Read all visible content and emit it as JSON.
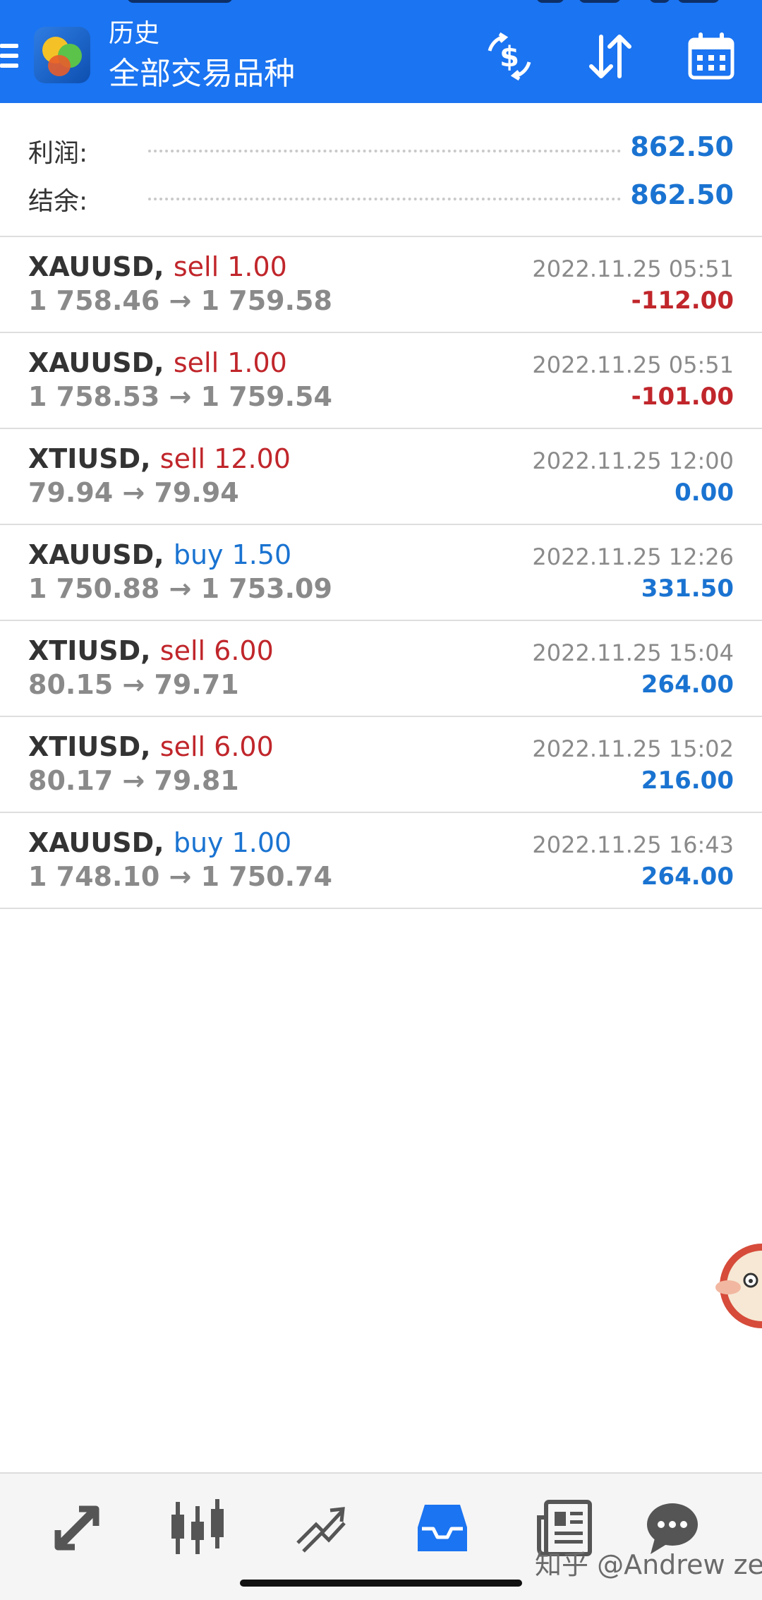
{
  "header": {
    "subtitle": "历史",
    "title": "全部交易品种",
    "icons": [
      "menu-icon",
      "app-logo",
      "currency-exchange-icon",
      "sort-icon",
      "calendar-icon"
    ]
  },
  "summary": {
    "profit_label": "利润:",
    "profit_value": "862.50",
    "balance_label": "结余:",
    "balance_value": "862.50"
  },
  "trades": [
    {
      "symbol": "XAUUSD,",
      "side": "sell 1.00",
      "prices": "1 758.46 → 1 759.58",
      "time": "2022.11.25 05:51",
      "profit": "-112.00"
    },
    {
      "symbol": "XAUUSD,",
      "side": "sell 1.00",
      "prices": "1 758.53 → 1 759.54",
      "time": "2022.11.25 05:51",
      "profit": "-101.00"
    },
    {
      "symbol": "XTIUSD,",
      "side": "sell 12.00",
      "prices": "79.94 → 79.94",
      "time": "2022.11.25 12:00",
      "profit": "0.00"
    },
    {
      "symbol": "XAUUSD,",
      "side": "buy 1.50",
      "prices": "1 750.88 → 1 753.09",
      "time": "2022.11.25 12:26",
      "profit": "331.50"
    },
    {
      "symbol": "XTIUSD,",
      "side": "sell 6.00",
      "prices": "80.15 → 79.71",
      "time": "2022.11.25 15:04",
      "profit": "264.00"
    },
    {
      "symbol": "XTIUSD,",
      "side": "sell 6.00",
      "prices": "80.17 → 79.81",
      "time": "2022.11.25 15:02",
      "profit": "216.00"
    },
    {
      "symbol": "XAUUSD,",
      "side": "buy 1.00",
      "prices": "1 748.10 → 1 750.74",
      "time": "2022.11.25 16:43",
      "profit": "264.00"
    }
  ],
  "bottom_nav": {
    "items": [
      "quotes-icon",
      "chart-icon",
      "trade-icon",
      "history-icon",
      "news-icon",
      "chat-icon"
    ],
    "active": "history-icon",
    "watermark": "知乎 @Andrew zeng"
  },
  "colors": {
    "header_bg": "#1b74f1",
    "sell": "#c0262b",
    "buy": "#1a73d1",
    "profit_positive": "#1a73d1",
    "profit_negative": "#c0262b",
    "muted": "#8a8a8a"
  }
}
